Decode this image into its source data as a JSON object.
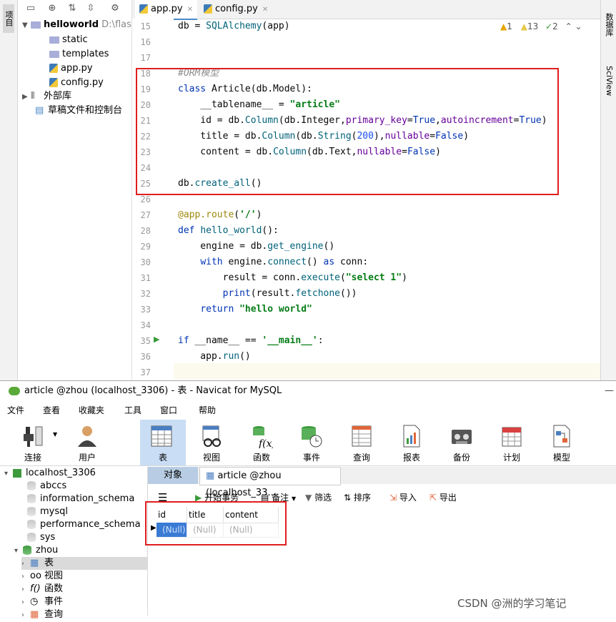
{
  "ide": {
    "left_tool_label": "项目",
    "right_tool_labels": [
      "数据库",
      "SciView"
    ],
    "project_tree": {
      "root": {
        "name": "helloworld",
        "path": "D:\\flask"
      },
      "items": [
        {
          "label": "static",
          "kind": "folder"
        },
        {
          "label": "templates",
          "kind": "folder"
        },
        {
          "label": "app.py",
          "kind": "py"
        },
        {
          "label": "config.py",
          "kind": "py"
        },
        {
          "label": "外部库",
          "kind": "lib"
        },
        {
          "label": "草稿文件和控制台",
          "kind": "scratch"
        }
      ]
    },
    "tabs": [
      {
        "label": "app.py",
        "active": true
      },
      {
        "label": "config.py",
        "active": false
      }
    ],
    "inspections": {
      "warnings": "1",
      "weak_warnings": "13",
      "typos": "2"
    },
    "line_numbers": [
      "15",
      "16",
      "17",
      "18",
      "19",
      "20",
      "21",
      "22",
      "23",
      "24",
      "25",
      "26",
      "27",
      "28",
      "29",
      "30",
      "31",
      "32",
      "33",
      "34",
      "35",
      "36",
      "37"
    ]
  },
  "navicat": {
    "window_title": "article @zhou (localhost_3306) - 表 - Navicat for MySQL",
    "menu": [
      "文件",
      "查看",
      "收藏夹",
      "工具",
      "窗口",
      "帮助"
    ],
    "toolbar": [
      {
        "label": "连接",
        "icon": "plug-icon"
      },
      {
        "label": "用户",
        "icon": "user-icon"
      },
      {
        "label": "表",
        "icon": "table-icon",
        "selected": true
      },
      {
        "label": "视图",
        "icon": "view-icon"
      },
      {
        "label": "函数",
        "icon": "function-icon"
      },
      {
        "label": "事件",
        "icon": "event-icon"
      },
      {
        "label": "查询",
        "icon": "query-icon"
      },
      {
        "label": "报表",
        "icon": "report-icon"
      },
      {
        "label": "备份",
        "icon": "backup-icon"
      },
      {
        "label": "计划",
        "icon": "calendar-icon"
      },
      {
        "label": "模型",
        "icon": "model-icon"
      }
    ],
    "tree": {
      "connection": "localhost_3306",
      "databases": [
        "abccs",
        "information_schema",
        "mysql",
        "performance_schema",
        "sys",
        "zhou"
      ],
      "zhou_children": [
        "表",
        "视图",
        "函数",
        "事件",
        "查询"
      ]
    },
    "tabs": {
      "objects": "对象",
      "table_tab": "article @zhou (localhost_33..."
    },
    "subtoolbar": {
      "begin_transaction": "开始事务",
      "memo": "备注",
      "filter": "筛选",
      "sort": "排序",
      "import": "导入",
      "export": "导出"
    },
    "grid": {
      "columns": [
        "id",
        "title",
        "content"
      ],
      "rows": [
        [
          "(Null)",
          "(Null)",
          "(Null)"
        ]
      ]
    }
  },
  "watermark": "CSDN @洲的学习笔记"
}
